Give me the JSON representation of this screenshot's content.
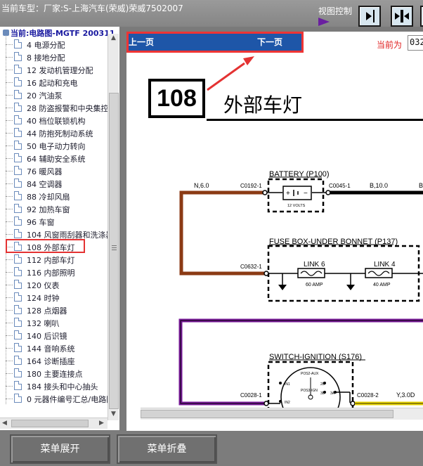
{
  "window": {
    "title": "当前车型：厂家:S-上海汽车(荣威)荣威7502007",
    "view_control_label": "视图控制"
  },
  "sidebar": {
    "root_label": "当前:电路图-MGTF 200311",
    "items": [
      {
        "label": "4 电源分配"
      },
      {
        "label": "8 接地分配"
      },
      {
        "label": "12 发动机管理分配"
      },
      {
        "label": "16 起动和充电"
      },
      {
        "label": "20 汽油泵"
      },
      {
        "label": "28 防盗报警和中央集控"
      },
      {
        "label": "40 档位联锁机构"
      },
      {
        "label": "44 防抱死制动系统"
      },
      {
        "label": "50 电子动力转向"
      },
      {
        "label": "64 辅助安全系统"
      },
      {
        "label": "76 暖风器"
      },
      {
        "label": "84 空调器"
      },
      {
        "label": "88 冷却风扇"
      },
      {
        "label": "92 加热车窗"
      },
      {
        "label": "96 车窗"
      },
      {
        "label": "104 风窗雨刮器和洗涤器"
      },
      {
        "label": "108 外部车灯",
        "selected": true
      },
      {
        "label": "112 内部车灯"
      },
      {
        "label": "116 内部照明"
      },
      {
        "label": "120 仪表"
      },
      {
        "label": "124 时钟"
      },
      {
        "label": "128 点烟器"
      },
      {
        "label": "132 喇叭"
      },
      {
        "label": "140 后识镜"
      },
      {
        "label": "144 音响系统"
      },
      {
        "label": "164 诊断插座"
      },
      {
        "label": "180 主要连接点"
      },
      {
        "label": "184 接头和中心抽头"
      },
      {
        "label": "0 元器件编号汇总/电路图"
      }
    ]
  },
  "viewer": {
    "prev_label": "上一页",
    "next_label": "下一页",
    "current_label": "当前为",
    "current_value": "032"
  },
  "diagram": {
    "page_number": "108",
    "page_title": "外部车灯",
    "battery_label": "BATTERY (P100)",
    "battery_volts": "12 VOLTS",
    "wire_n60": "N,6.0",
    "conn_c0192": "C0192-1",
    "conn_c0045": "C0045-1",
    "wire_b100": "B,10.0",
    "wire_b_cut": "B",
    "fusebox_label": "FUSE BOX-UNDER BONNET (P137)",
    "conn_c0632": "C0632-1",
    "link6": "LINK 6",
    "link6_amp": "60 AMP",
    "link4": "LINK 4",
    "link4_amp": "40 AMP",
    "switch_label": "SWITCH-IGNITION (S176)",
    "conn_c0028_1": "C0028-1",
    "conn_c0028_2": "C0028-2",
    "wire_y30d": "Y,3.0D",
    "sw_pos2aux": "POS2-AUX",
    "sw_pos3ign": "POS3-IGN",
    "sw_in1": "IN1",
    "sw_in2": "IN2",
    "sw_2b": "2B",
    "sw_3b": "3B",
    "sw_3a": "3A"
  },
  "bottom": {
    "expand_label": "菜单展开",
    "collapse_label": "菜单折叠"
  },
  "colors": {
    "accent_blue": "#1e56a8",
    "highlight_red": "#ee3434",
    "wire_brown": "#8b3a14",
    "wire_purple": "#7a1a9a",
    "wire_yellow": "#e8d400"
  }
}
